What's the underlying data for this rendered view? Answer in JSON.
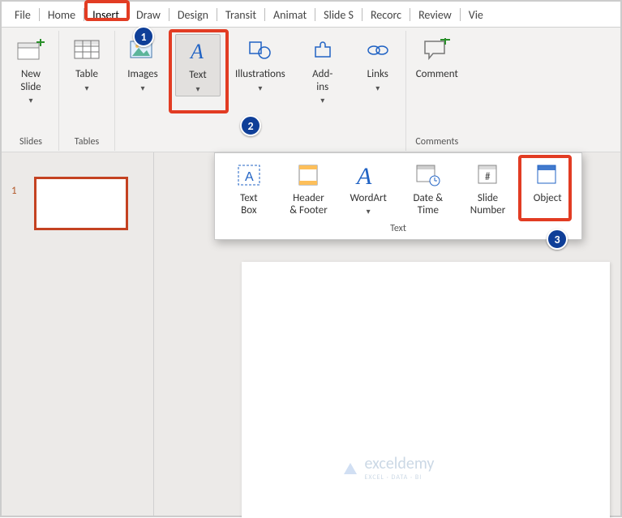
{
  "tabs": {
    "file": "File",
    "home": "Home",
    "insert": "Insert",
    "draw": "Draw",
    "design": "Design",
    "transit": "Transit",
    "animat": "Animat",
    "slide_s": "Slide S",
    "record": "Recorc",
    "review": "Review",
    "view": "Vie"
  },
  "ribbon": {
    "slides": {
      "new_slide": "New\nSlide",
      "group": "Slides"
    },
    "tables": {
      "table": "Table",
      "group": "Tables"
    },
    "images": {
      "images": "Images"
    },
    "text": {
      "text": "Text"
    },
    "illustrations": {
      "illustrations": "Illustrations"
    },
    "addins": {
      "addins": "Add-\nins"
    },
    "links": {
      "links": "Links"
    },
    "comments": {
      "comment": "Comment",
      "group": "Comments"
    }
  },
  "dropdown": {
    "text_box": "Text\nBox",
    "header_footer": "Header\n& Footer",
    "wordart": "WordArt",
    "date_time": "Date &\nTime",
    "slide_number": "Slide\nNumber",
    "object": "Object",
    "group": "Text"
  },
  "slide": {
    "number": "1"
  },
  "callouts": {
    "one": "1",
    "two": "2",
    "three": "3"
  },
  "watermark": {
    "brand": "exceldemy",
    "tag": "EXCEL · DATA · BI"
  }
}
